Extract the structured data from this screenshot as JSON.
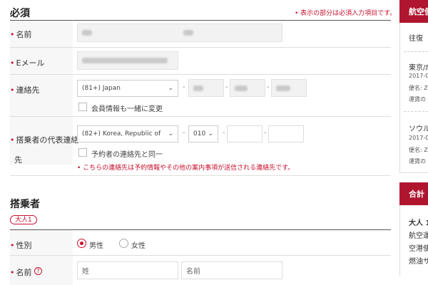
{
  "required": {
    "title": "必須",
    "note": "• 表示の部分は必須入力項目です。"
  },
  "fields": {
    "name_label": "名前",
    "email_label": "Eメール",
    "contact_label": "連絡先",
    "contact_country": "(81+) Japan",
    "member_update_label": "会員情報も一緒に変更",
    "rep_label_line1": "搭乗者の代表連絡",
    "rep_label_line2": "先",
    "rep_country": "(82+) Korea, Republic of",
    "rep_prefix": "010",
    "same_as_booker_label": "予約者の連絡先と同一",
    "rep_notice": "• こちらの連絡先は予約情報やその他の案内事項が送信される連絡先です。"
  },
  "passenger": {
    "title": "搭乗者",
    "badge": "大人1",
    "gender_label": "性別",
    "male": "男性",
    "female": "女性",
    "name_label": "名前",
    "surname_placeholder": "姓",
    "given_placeholder": "名前"
  },
  "sidebar": {
    "flight_header": "航空便",
    "trip_type": "往復",
    "seg1_route": "東京/成",
    "seg1_date": "2017-0",
    "seg1_flight": "便名: Z",
    "seg1_fare": "運賃の",
    "seg2_route": "ソウル",
    "seg2_date": "2017-0",
    "seg2_flight": "便名: Z",
    "seg2_fare": "運賃の",
    "total_header": "合計",
    "pax": "大人 1",
    "fare1": "航空運",
    "fare2": "空港使",
    "fare3": "燃油サ"
  },
  "colors": {
    "accent": "#c8102e",
    "panel_header": "#b0152f"
  }
}
